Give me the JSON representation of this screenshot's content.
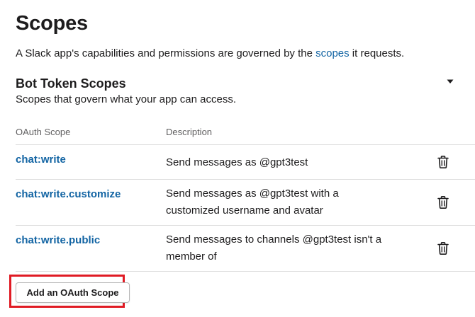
{
  "page": {
    "title": "Scopes",
    "intro_before": "A Slack app's capabilities and permissions are governed by the ",
    "intro_link": "scopes",
    "intro_after": " it requests."
  },
  "section": {
    "title": "Bot Token Scopes",
    "subtitle": "Scopes that govern what your app can access.",
    "toggle_icon": "caret-down-icon"
  },
  "table": {
    "columns": [
      "OAuth Scope",
      "Description"
    ],
    "rows": [
      {
        "scope": "chat:write",
        "description": "Send messages as @gpt3test"
      },
      {
        "scope": "chat:write.customize",
        "description": "Send messages as @gpt3test with a customized username and avatar"
      },
      {
        "scope": "chat:write.public",
        "description": "Send messages to channels @gpt3test isn't a member of"
      }
    ],
    "row_action_icon": "trash-icon"
  },
  "add_button": {
    "label": "Add an OAuth Scope"
  },
  "colors": {
    "link": "#1264a3",
    "text": "#1d1c1d",
    "muted": "#616061",
    "divider": "#dddddd",
    "highlight": "#e01b24"
  }
}
